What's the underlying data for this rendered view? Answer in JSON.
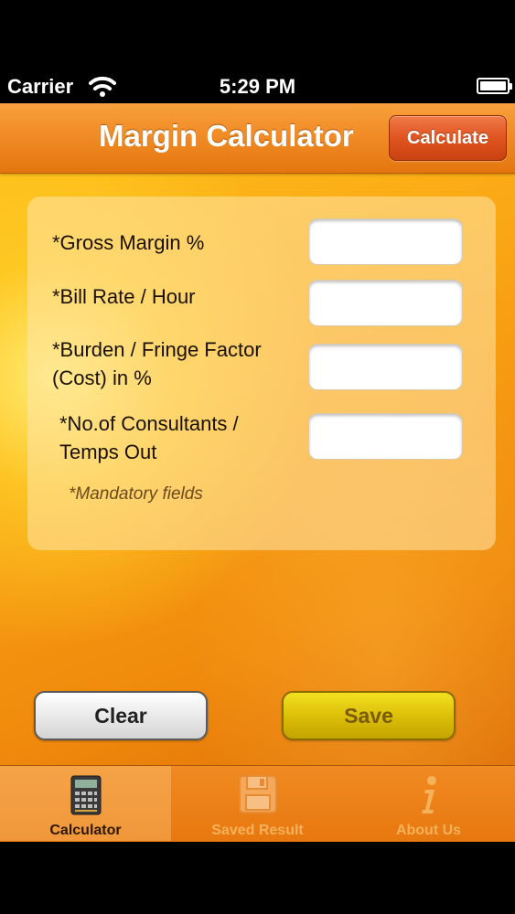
{
  "status_bar": {
    "carrier": "Carrier",
    "time": "5:29 PM"
  },
  "nav": {
    "title": "Margin Calculator",
    "calculate_label": "Calculate"
  },
  "form": {
    "fields": [
      {
        "label_line1": "*Gross Margin %",
        "label_line2": "",
        "value": ""
      },
      {
        "label_line1": "*Bill Rate / Hour",
        "label_line2": "",
        "value": ""
      },
      {
        "label_line1": "*Burden / Fringe Factor",
        "label_line2": "(Cost) in %",
        "value": ""
      },
      {
        "label_line1": "*No.of Consultants /",
        "label_line2": "Temps Out",
        "value": ""
      }
    ],
    "mandatory_note": "*Mandatory fields"
  },
  "actions": {
    "clear_label": "Clear",
    "save_label": "Save"
  },
  "tabs": [
    {
      "label": "Calculator",
      "icon": "calculator-icon",
      "selected": true
    },
    {
      "label": "Saved Result",
      "icon": "floppy-disk-icon",
      "selected": false
    },
    {
      "label": "About Us",
      "icon": "info-icon",
      "selected": false
    }
  ],
  "colors": {
    "accent_orange": "#f08a24",
    "calculate_red": "#e05420",
    "save_yellow": "#dcc009"
  }
}
